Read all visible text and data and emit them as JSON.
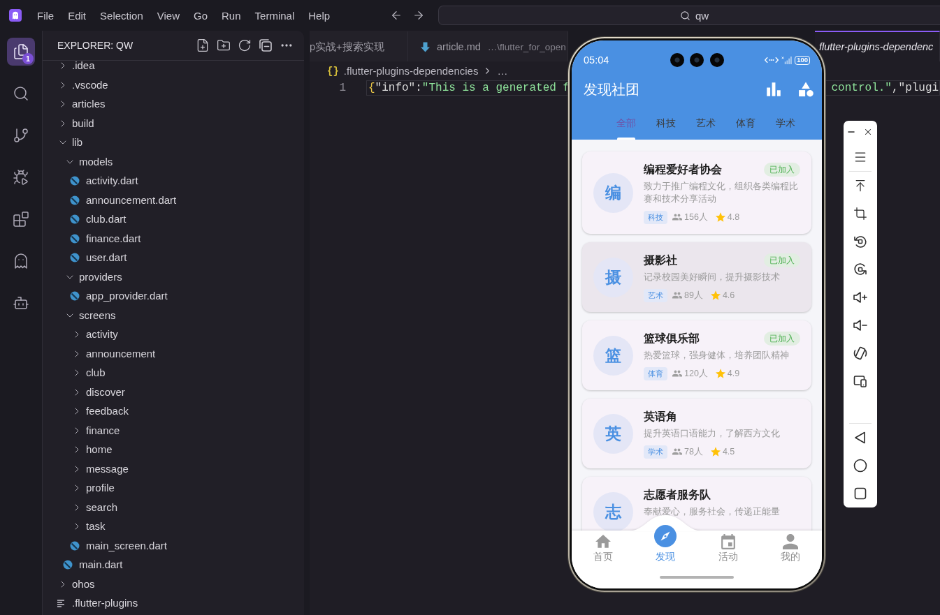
{
  "title_bar": {
    "menu": [
      "File",
      "Edit",
      "Selection",
      "View",
      "Go",
      "Run",
      "Terminal",
      "Help"
    ],
    "command_center": "qw"
  },
  "activity_bar": {
    "items": [
      {
        "selected": true,
        "badge": "1"
      },
      {
        "selected": false
      },
      {
        "selected": false
      },
      {
        "selected": false
      },
      {
        "selected": false
      },
      {
        "selected": false
      },
      {
        "selected": false
      }
    ]
  },
  "explorer": {
    "title": "EXPLORER: QW",
    "tree": [
      {
        "name": ".idea",
        "kind": "folder",
        "expanded": false
      },
      {
        "name": ".vscode",
        "kind": "folder",
        "expanded": false
      },
      {
        "name": "articles",
        "kind": "folder",
        "expanded": false
      },
      {
        "name": "build",
        "kind": "folder",
        "expanded": false
      },
      {
        "name": "lib",
        "kind": "folder",
        "expanded": true,
        "children": [
          {
            "name": "models",
            "kind": "folder",
            "expanded": true,
            "children": [
              {
                "name": "activity.dart",
                "kind": "dart"
              },
              {
                "name": "announcement.dart",
                "kind": "dart"
              },
              {
                "name": "club.dart",
                "kind": "dart"
              },
              {
                "name": "finance.dart",
                "kind": "dart"
              },
              {
                "name": "user.dart",
                "kind": "dart"
              }
            ]
          },
          {
            "name": "providers",
            "kind": "folder",
            "expanded": true,
            "children": [
              {
                "name": "app_provider.dart",
                "kind": "dart"
              }
            ]
          },
          {
            "name": "screens",
            "kind": "folder",
            "expanded": true,
            "children": [
              {
                "name": "activity",
                "kind": "folder",
                "expanded": false
              },
              {
                "name": "announcement",
                "kind": "folder",
                "expanded": false
              },
              {
                "name": "club",
                "kind": "folder",
                "expanded": false
              },
              {
                "name": "discover",
                "kind": "folder",
                "expanded": false
              },
              {
                "name": "feedback",
                "kind": "folder",
                "expanded": false
              },
              {
                "name": "finance",
                "kind": "folder",
                "expanded": false
              },
              {
                "name": "home",
                "kind": "folder",
                "expanded": false
              },
              {
                "name": "message",
                "kind": "folder",
                "expanded": false
              },
              {
                "name": "profile",
                "kind": "folder",
                "expanded": false
              },
              {
                "name": "search",
                "kind": "folder",
                "expanded": false
              },
              {
                "name": "task",
                "kind": "folder",
                "expanded": false
              },
              {
                "name": "main_screen.dart",
                "kind": "dart"
              }
            ]
          },
          {
            "name": "main.dart",
            "kind": "dart"
          }
        ]
      },
      {
        "name": "ohos",
        "kind": "folder",
        "expanded": false
      },
      {
        "name": ".flutter-plugins",
        "kind": "text"
      }
    ]
  },
  "editor": {
    "tabs": [
      {
        "kind": "clipped",
        "label": "p实战+搜索实现",
        "selected": false,
        "preview": false
      },
      {
        "kind": "markdown",
        "label": "article.md",
        "description": "…\\flutter_for_open",
        "selected": false,
        "preview": false
      },
      {
        "kind": "covered",
        "label": "flutter-plugins-dependenc",
        "selected": true,
        "preview": true
      }
    ],
    "breadcrumb": {
      "icon": "{}",
      "items": [
        ".flutter-plugins-dependencies",
        "…"
      ]
    },
    "lines": [
      {
        "number": "1",
        "current": true,
        "fragments": [
          [
            {
              "kind": "brace",
              "text": "{"
            },
            {
              "kind": "key",
              "text": "\"info\""
            },
            {
              "kind": "punct",
              "text": ":"
            },
            {
              "kind": "string",
              "text": "\"This is a generated f"
            }
          ],
          [
            {
              "kind": "string",
              "text": "control.\""
            },
            {
              "kind": "punct",
              "text": ","
            },
            {
              "kind": "key",
              "text": "\"plugi"
            }
          ]
        ]
      }
    ]
  },
  "emulator": {
    "status_bar": {
      "time": "05:04",
      "battery": "100"
    },
    "app_bar": {
      "title": "发现社团"
    },
    "tabs": [
      {
        "label": "全部",
        "selected": true
      },
      {
        "label": "科技",
        "selected": false
      },
      {
        "label": "艺术",
        "selected": false
      },
      {
        "label": "体育",
        "selected": false
      },
      {
        "label": "学术",
        "selected": false
      }
    ],
    "clubs": [
      {
        "avatar": "编",
        "name": "编程爱好者协会",
        "badge": "已加入",
        "description": "致力于推广编程文化，组织各类编程比赛和技术分享活动",
        "category": "科技",
        "members": "156人",
        "rating": "4.8",
        "highlighted": false
      },
      {
        "avatar": "摄",
        "name": "摄影社",
        "badge": "已加入",
        "description": "记录校园美好瞬间，提升摄影技术",
        "category": "艺术",
        "members": "89人",
        "rating": "4.6",
        "highlighted": true
      },
      {
        "avatar": "篮",
        "name": "篮球俱乐部",
        "badge": "已加入",
        "description": "热爱篮球，强身健体，培养团队精神",
        "category": "体育",
        "members": "120人",
        "rating": "4.9",
        "highlighted": false
      },
      {
        "avatar": "英",
        "name": "英语角",
        "description": "提升英语口语能力，了解西方文化",
        "category": "学术",
        "members": "78人",
        "rating": "4.5",
        "highlighted": false
      },
      {
        "avatar": "志",
        "name": "志愿者服务队",
        "description": "奉献爱心，服务社会，传递正能量",
        "highlighted": false
      }
    ],
    "bottom_nav": [
      {
        "label": "首页",
        "selected": false
      },
      {
        "label": "发现",
        "selected": true
      },
      {
        "label": "活动",
        "selected": false
      },
      {
        "label": "我的",
        "selected": false
      }
    ]
  }
}
